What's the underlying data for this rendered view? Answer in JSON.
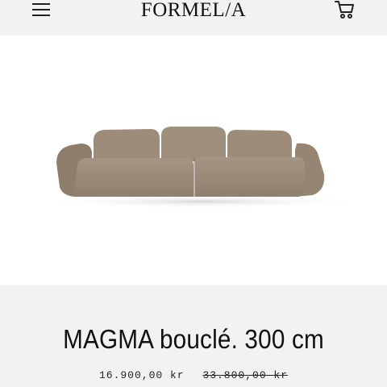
{
  "header": {
    "logo": "FORMEL/A",
    "menu_icon": "hamburger-menu-icon",
    "cart_icon": "shopping-cart-icon"
  },
  "product": {
    "title": "MAGMA bouclé. 300 cm",
    "price": "16.900,00 kr",
    "compare_at_price": "33.800,00 kr",
    "image_color": "#a08f7d"
  }
}
